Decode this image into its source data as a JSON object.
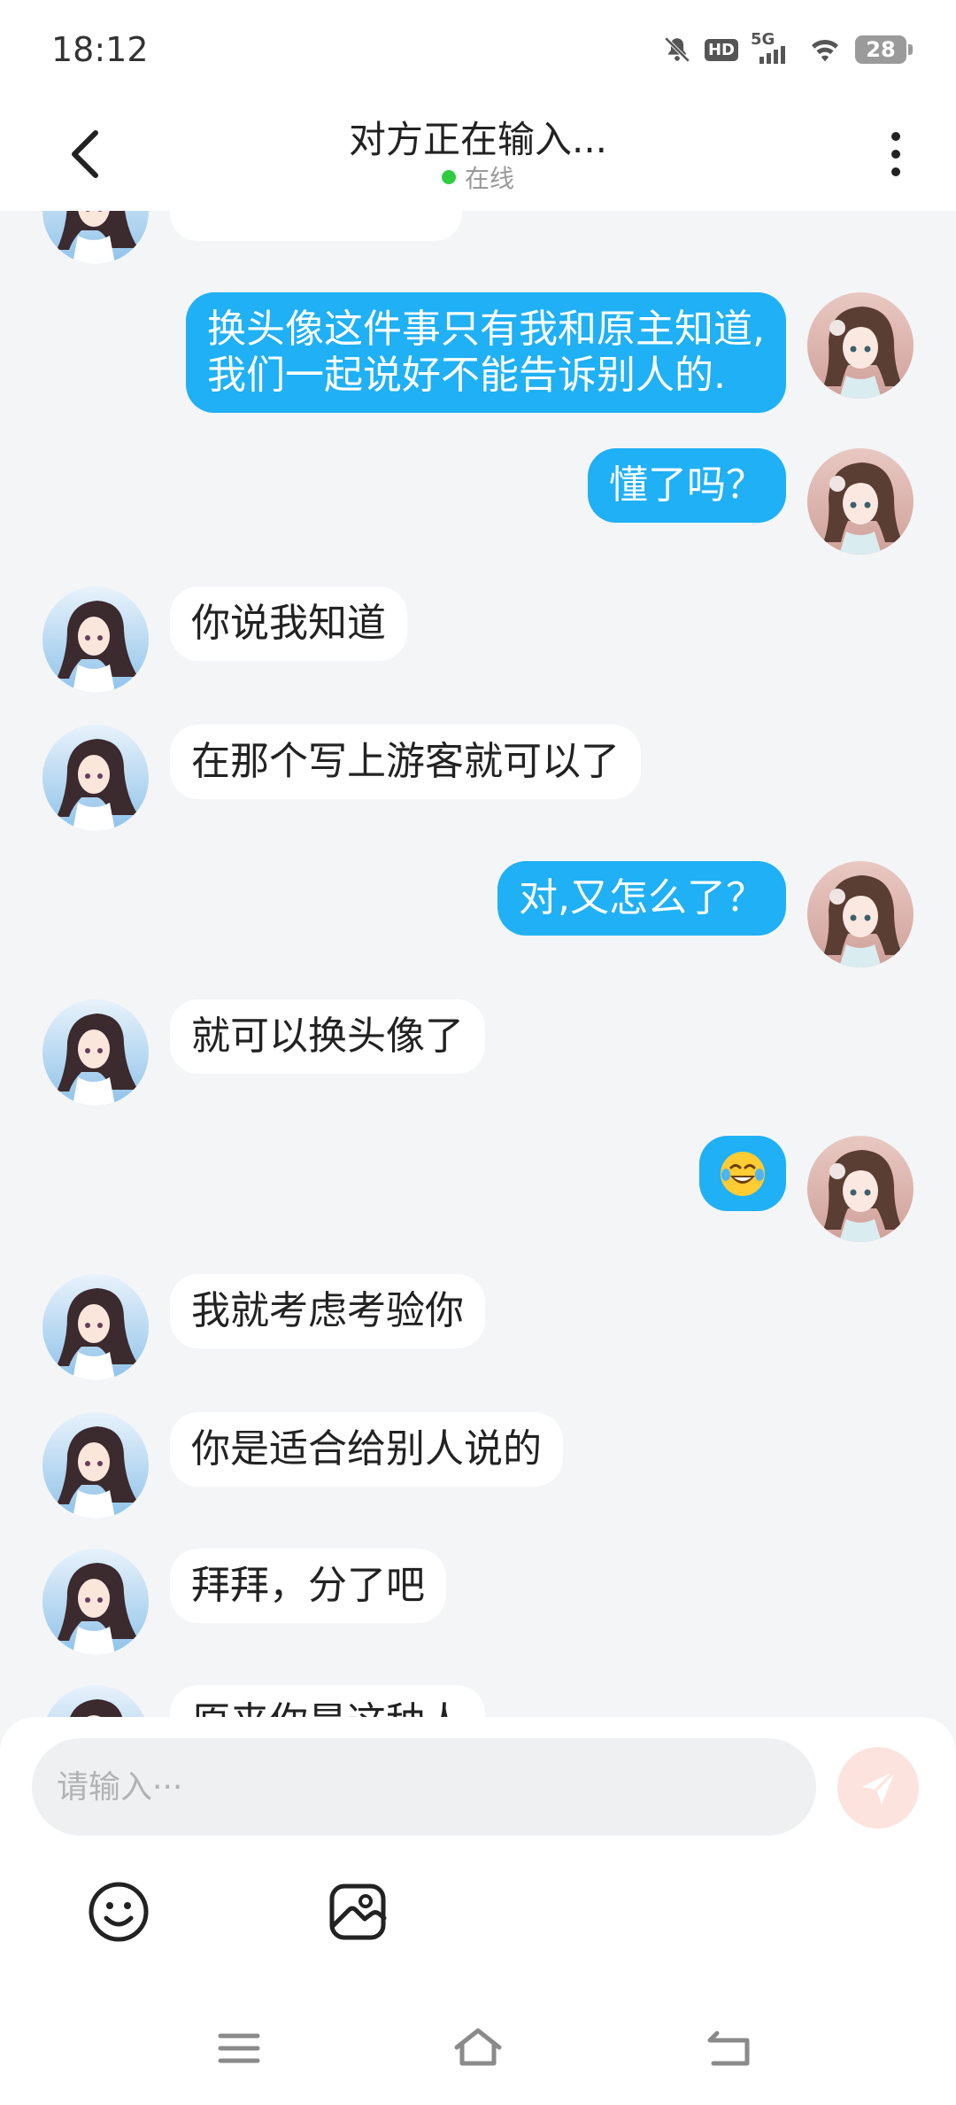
{
  "status_bar": {
    "time": "18:12",
    "network": "5G",
    "hd_label": "HD",
    "battery": "28"
  },
  "header": {
    "title": "对方正在输入...",
    "status": "在线",
    "status_color": "#2ecc40"
  },
  "colors": {
    "outgoing_bubble": "#1fb0f5",
    "incoming_bubble": "#ffffff",
    "background": "#f4f5f7",
    "send_button": "#fde3dd"
  },
  "messages": [
    {
      "from": "them",
      "text": ""
    },
    {
      "from": "me",
      "text": "换头像这件事只有我和原主知道,",
      "text2": "我们一起说好不能告诉别人的."
    },
    {
      "from": "me",
      "text": "懂了吗？"
    },
    {
      "from": "them",
      "text": "你说我知道"
    },
    {
      "from": "them",
      "text": "在那个写上游客就可以了"
    },
    {
      "from": "me",
      "text": "对,又怎么了？"
    },
    {
      "from": "them",
      "text": "就可以换头像了"
    },
    {
      "from": "me",
      "emoji": "face-with-tears-of-joy"
    },
    {
      "from": "them",
      "text": "我就考虑考验你"
    },
    {
      "from": "them",
      "text": "你是适合给别人说的"
    },
    {
      "from": "them",
      "text": "拜拜，分了吧"
    },
    {
      "from": "them",
      "text": "原来你是这种人"
    }
  ],
  "composer": {
    "placeholder": "请输入···",
    "icons": [
      "smiley-icon",
      "image-icon",
      "send-icon"
    ]
  },
  "nav_bar": {
    "icons": [
      "menu-icon",
      "home-icon",
      "back-nav-icon"
    ]
  }
}
